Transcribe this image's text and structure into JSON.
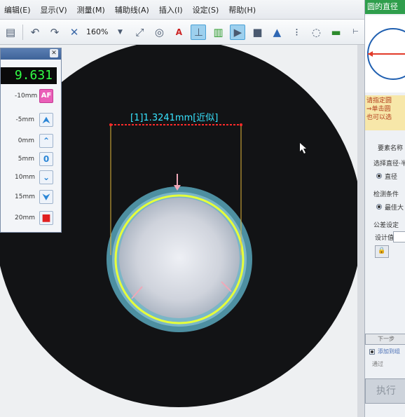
{
  "menu": [
    "编辑(E)",
    "显示(V)",
    "测量(M)",
    "辅助线(A)",
    "插入(I)",
    "设定(S)",
    "帮助(H)"
  ],
  "toolbar": {
    "zoom": "160%"
  },
  "measurement": {
    "label": "[1]1.3241mm[近似]"
  },
  "focus_panel": {
    "readout": "9.631",
    "af_label": "AF",
    "steps": [
      {
        "label": "-10mm"
      },
      {
        "label": "-5mm"
      },
      {
        "label": "0mm"
      },
      {
        "label": "5mm"
      },
      {
        "label": "10mm"
      },
      {
        "label": "15mm"
      },
      {
        "label": "20mm"
      }
    ],
    "zero_label": "0"
  },
  "right_panel": {
    "title": "圆的直径",
    "hint_line1": "请指定圆",
    "hint_line2": "⇒单击圆",
    "hint_line3": "也可以选",
    "element_name": "要素名称",
    "select_diameter": "选择直径·半",
    "radio_diameter": "直径",
    "detect_conditions": "检测条件",
    "radio_best": "最佳大",
    "tolerance": "公差设定",
    "design_value": "设计值",
    "next_step": "下一步",
    "checkbox_text": "添加到组",
    "pass_label": "通过",
    "execute": "执行"
  },
  "colors": {
    "accent_green": "#2f9e4c",
    "readout_green": "#32ff46",
    "measure_cyan": "#38e4ff",
    "circle_yellow": "#e6ff3a",
    "dimension_red": "#ff2a2a"
  }
}
